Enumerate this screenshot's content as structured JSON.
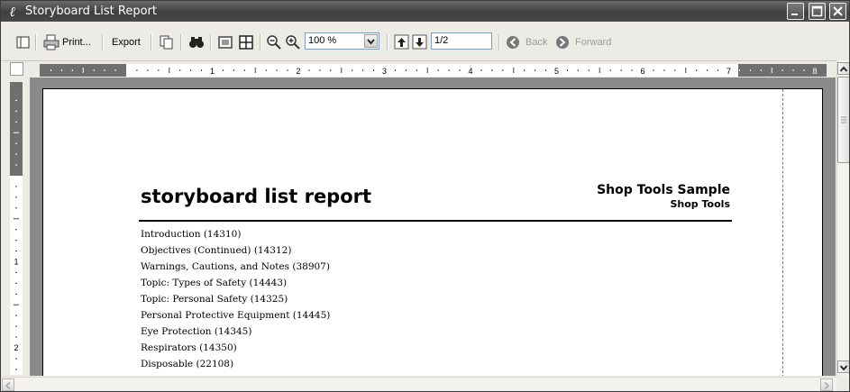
{
  "window": {
    "title": "Storyboard List Report"
  },
  "toolbar": {
    "print_label": "Print...",
    "export_label": "Export",
    "zoom_value": "100 %",
    "page_value": "1/2",
    "back_label": "Back",
    "forward_label": "Forward"
  },
  "ruler": {
    "h_numbers": [
      "1",
      "2",
      "3",
      "4",
      "5",
      "6",
      "7",
      "8"
    ],
    "v_numbers": [
      "1",
      "2"
    ]
  },
  "report": {
    "title": "storyboard list report",
    "company": "Shop Tools Sample",
    "subcompany": "Shop Tools",
    "items": [
      "Introduction (14310)",
      "Objectives (Continued) (14312)",
      "Warnings, Cautions, and Notes (38907)",
      "Topic: Types of Safety (14443)",
      "Topic: Personal Safety (14325)",
      "Personal Protective Equipment (14445)",
      "Eye Protection (14345)",
      "Respirators (14350)",
      "Disposable (22108)"
    ]
  },
  "colors": {
    "titlebar": "#4a4a4a",
    "toolbar": "#ecebe6",
    "page_background": "#8a8a8a",
    "ruler_margin": "#6f6f6f"
  },
  "icons": [
    "app-icon",
    "page-setup-icon",
    "printer-icon",
    "copy-icon",
    "find-icon",
    "single-page-icon",
    "multi-page-icon",
    "zoom-out-icon",
    "zoom-in-icon",
    "first-page-icon",
    "next-page-icon",
    "back-arrow-icon",
    "forward-arrow-icon",
    "minimize-icon",
    "maximize-icon",
    "close-icon"
  ]
}
